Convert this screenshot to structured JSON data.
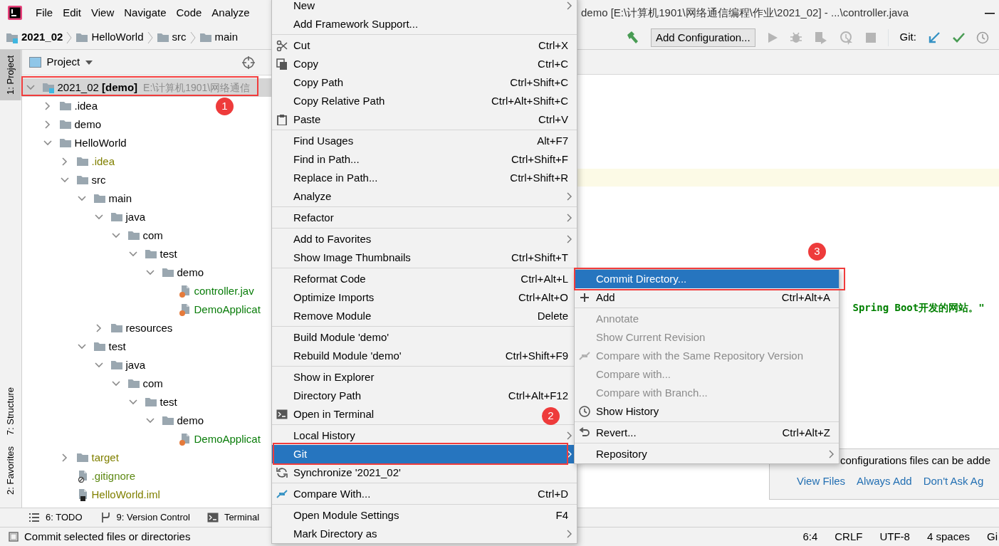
{
  "menu_bar": {
    "items": [
      "File",
      "Edit",
      "View",
      "Navigate",
      "Code",
      "Analyze"
    ]
  },
  "window": {
    "title": "demo [E:\\计算机1901\\网络通信编程\\作业\\2021_02] - ...\\controller.java"
  },
  "breadcrumbs": [
    {
      "label": "2021_02",
      "kind": "module"
    },
    {
      "label": "HelloWorld",
      "kind": "folder"
    },
    {
      "label": "src",
      "kind": "folder"
    },
    {
      "label": "main",
      "kind": "folder"
    }
  ],
  "toolbar": {
    "config_button": "Add Configuration...",
    "git_label": "Git:"
  },
  "left_tool_tabs": [
    {
      "label": "1: Project",
      "selected": true
    },
    {
      "label": "7: Structure",
      "selected": false
    },
    {
      "label": "2: Favorites",
      "selected": false
    }
  ],
  "project_panel": {
    "title": "Project",
    "tree": [
      {
        "label": "2021_02 **[demo]**",
        "path": "E:\\计算机1901\\网络通信",
        "kind": "module",
        "expanded": true,
        "selected": true,
        "children": [
          {
            "label": ".idea",
            "kind": "folder",
            "expanded": false,
            "selected": false
          },
          {
            "label": "demo",
            "kind": "folder",
            "expanded": false,
            "selected": false
          },
          {
            "label": "HelloWorld",
            "kind": "folder",
            "expanded": true,
            "selected": false,
            "children": [
              {
                "label": ".idea",
                "kind": "folder",
                "expanded": false,
                "selected": false,
                "color": "#808000"
              },
              {
                "label": "src",
                "kind": "folder",
                "expanded": true,
                "selected": false,
                "children": [
                  {
                    "label": "main",
                    "kind": "folder",
                    "expanded": true,
                    "selected": false,
                    "children": [
                      {
                        "label": "java",
                        "kind": "folder",
                        "expanded": true,
                        "selected": false,
                        "children": [
                          {
                            "label": "com",
                            "kind": "folder",
                            "expanded": true,
                            "selected": false,
                            "children": [
                              {
                                "label": "test",
                                "kind": "folder",
                                "expanded": true,
                                "selected": false,
                                "children": [
                                  {
                                    "label": "demo",
                                    "kind": "folder",
                                    "expanded": true,
                                    "selected": false,
                                    "children": [
                                      {
                                        "label": "controller.jav",
                                        "kind": "javafile",
                                        "selected": false,
                                        "color": "#0a7d0a"
                                      },
                                      {
                                        "label": "DemoApplicat",
                                        "kind": "javafile",
                                        "selected": false,
                                        "color": "#0a7d0a"
                                      }
                                    ]
                                  }
                                ]
                              }
                            ]
                          }
                        ]
                      },
                      {
                        "label": "resources",
                        "kind": "folder",
                        "expanded": false,
                        "selected": false
                      }
                    ]
                  },
                  {
                    "label": "test",
                    "kind": "folder",
                    "expanded": true,
                    "selected": false,
                    "children": [
                      {
                        "label": "java",
                        "kind": "folder",
                        "expanded": true,
                        "selected": false,
                        "children": [
                          {
                            "label": "com",
                            "kind": "folder",
                            "expanded": true,
                            "selected": false,
                            "children": [
                              {
                                "label": "test",
                                "kind": "folder",
                                "expanded": true,
                                "selected": false,
                                "children": [
                                  {
                                    "label": "demo",
                                    "kind": "folder",
                                    "expanded": true,
                                    "selected": false,
                                    "children": [
                                      {
                                        "label": "DemoApplicat",
                                        "kind": "javafile",
                                        "selected": false,
                                        "color": "#0a7d0a"
                                      }
                                    ]
                                  }
                                ]
                              }
                            ]
                          }
                        ]
                      }
                    ]
                  }
                ]
              },
              {
                "label": "target",
                "kind": "folder",
                "expanded": false,
                "selected": false,
                "color": "#808000"
              },
              {
                "label": ".gitignore",
                "kind": "ignorefile",
                "selected": false,
                "color": "#5f8a16"
              },
              {
                "label": "HelloWorld.iml",
                "kind": "imlfile",
                "selected": false,
                "color": "#808000"
              }
            ]
          }
        ]
      }
    ]
  },
  "editor": {
    "code_line": "Spring Boot开发的网站。\""
  },
  "notification": {
    "message": "configurations files can be adde",
    "links": [
      "View Files",
      "Always Add",
      "Don't Ask Ag"
    ]
  },
  "bottom_tool_tabs": [
    "6: TODO",
    "9: Version Control",
    "Terminal"
  ],
  "status_bar": {
    "message": "Commit selected files or directories",
    "items": [
      "6:4",
      "CRLF",
      "UTF-8",
      "4 spaces",
      "Gi"
    ]
  },
  "context_menu": {
    "items": [
      {
        "kind": "item",
        "label": "New",
        "has_submenu": true,
        "selected": false
      },
      {
        "kind": "item",
        "label": "Add Framework Support...",
        "selected": false
      },
      {
        "kind": "separator"
      },
      {
        "kind": "item",
        "label": "Cut",
        "shortcut": "Ctrl+X",
        "selected": false
      },
      {
        "kind": "item",
        "label": "Copy",
        "shortcut": "Ctrl+C",
        "selected": false
      },
      {
        "kind": "item",
        "label": "Copy Path",
        "shortcut": "Ctrl+Shift+C",
        "selected": false
      },
      {
        "kind": "item",
        "label": "Copy Relative Path",
        "shortcut": "Ctrl+Alt+Shift+C",
        "selected": false
      },
      {
        "kind": "item",
        "label": "Paste",
        "shortcut": "Ctrl+V",
        "selected": false
      },
      {
        "kind": "separator"
      },
      {
        "kind": "item",
        "label": "Find Usages",
        "shortcut": "Alt+F7",
        "selected": false
      },
      {
        "kind": "item",
        "label": "Find in Path...",
        "shortcut": "Ctrl+Shift+F",
        "selected": false
      },
      {
        "kind": "item",
        "label": "Replace in Path...",
        "shortcut": "Ctrl+Shift+R",
        "selected": false
      },
      {
        "kind": "item",
        "label": "Analyze",
        "has_submenu": true,
        "selected": false
      },
      {
        "kind": "separator"
      },
      {
        "kind": "item",
        "label": "Refactor",
        "has_submenu": true,
        "selected": false
      },
      {
        "kind": "separator"
      },
      {
        "kind": "item",
        "label": "Add to Favorites",
        "has_submenu": true,
        "selected": false
      },
      {
        "kind": "item",
        "label": "Show Image Thumbnails",
        "shortcut": "Ctrl+Shift+T",
        "selected": false
      },
      {
        "kind": "separator"
      },
      {
        "kind": "item",
        "label": "Reformat Code",
        "shortcut": "Ctrl+Alt+L",
        "selected": false
      },
      {
        "kind": "item",
        "label": "Optimize Imports",
        "shortcut": "Ctrl+Alt+O",
        "selected": false
      },
      {
        "kind": "item",
        "label": "Remove Module",
        "shortcut": "Delete",
        "selected": false
      },
      {
        "kind": "separator"
      },
      {
        "kind": "item",
        "label": "Build Module 'demo'",
        "selected": false
      },
      {
        "kind": "item",
        "label": "Rebuild Module 'demo'",
        "shortcut": "Ctrl+Shift+F9",
        "selected": false
      },
      {
        "kind": "separator"
      },
      {
        "kind": "item",
        "label": "Show in Explorer",
        "selected": false
      },
      {
        "kind": "item",
        "label": "Directory Path",
        "shortcut": "Ctrl+Alt+F12",
        "selected": false
      },
      {
        "kind": "item",
        "label": "Open in Terminal",
        "selected": false
      },
      {
        "kind": "separator"
      },
      {
        "kind": "item",
        "label": "Local History",
        "has_submenu": true,
        "selected": false
      },
      {
        "kind": "item",
        "label": "Git",
        "has_submenu": true,
        "selected": true
      },
      {
        "kind": "item",
        "label": "Synchronize '2021_02'",
        "selected": false
      },
      {
        "kind": "separator"
      },
      {
        "kind": "item",
        "label": "Compare With...",
        "shortcut": "Ctrl+D",
        "selected": false
      },
      {
        "kind": "separator"
      },
      {
        "kind": "item",
        "label": "Open Module Settings",
        "shortcut": "F4",
        "selected": false
      },
      {
        "kind": "item",
        "label": "Mark Directory as",
        "has_submenu": true,
        "selected": false
      }
    ]
  },
  "git_submenu": {
    "items": [
      {
        "kind": "item",
        "label": "Commit Directory...",
        "selected": true,
        "disabled": false
      },
      {
        "kind": "item",
        "label": "Add",
        "shortcut": "Ctrl+Alt+A",
        "selected": false,
        "disabled": false
      },
      {
        "kind": "separator"
      },
      {
        "kind": "item",
        "label": "Annotate",
        "selected": false,
        "disabled": true
      },
      {
        "kind": "item",
        "label": "Show Current Revision",
        "selected": false,
        "disabled": true
      },
      {
        "kind": "item",
        "label": "Compare with the Same Repository Version",
        "selected": false,
        "disabled": true
      },
      {
        "kind": "item",
        "label": "Compare with...",
        "selected": false,
        "disabled": true
      },
      {
        "kind": "item",
        "label": "Compare with Branch...",
        "selected": false,
        "disabled": true
      },
      {
        "kind": "item",
        "label": "Show History",
        "selected": false,
        "disabled": false
      },
      {
        "kind": "separator"
      },
      {
        "kind": "item",
        "label": "Revert...",
        "shortcut": "Ctrl+Alt+Z",
        "selected": false,
        "disabled": false
      },
      {
        "kind": "separator"
      },
      {
        "kind": "item",
        "label": "Repository",
        "has_submenu": true,
        "selected": false,
        "disabled": false
      }
    ]
  },
  "annotations": [
    {
      "label": "1"
    },
    {
      "label": "2"
    },
    {
      "label": "3"
    }
  ]
}
